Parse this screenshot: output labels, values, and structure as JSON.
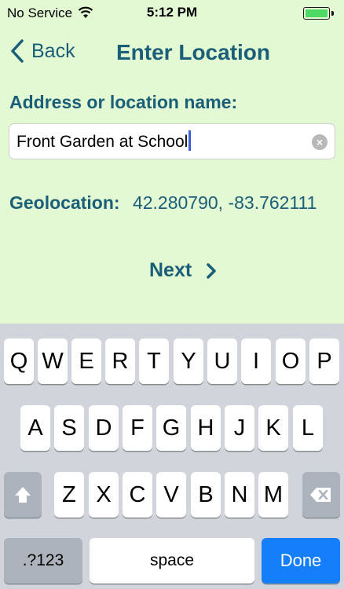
{
  "status_bar": {
    "carrier": "No Service",
    "time": "5:12 PM",
    "battery_level": 1.0,
    "battery_color": "#4cd964",
    "wifi_icon": "wifi-icon"
  },
  "nav": {
    "back_label": "Back",
    "title": "Enter Location"
  },
  "form": {
    "address_label": "Address or location name:",
    "address_value": "Front Garden at School",
    "geolocation_label": "Geolocation:",
    "geolocation_value": "42.280790, -83.762111",
    "next_label": "Next"
  },
  "keyboard": {
    "row1": [
      "Q",
      "W",
      "E",
      "R",
      "T",
      "Y",
      "U",
      "I",
      "O",
      "P"
    ],
    "row2": [
      "A",
      "S",
      "D",
      "F",
      "G",
      "H",
      "J",
      "K",
      "L"
    ],
    "row3": [
      "Z",
      "X",
      "C",
      "V",
      "B",
      "N",
      "M"
    ],
    "numbers_key": ".?123",
    "space_key": "space",
    "done_key": "Done"
  },
  "colors": {
    "background": "#e2f9d4",
    "accent": "#1b5e78",
    "done": "#157efb"
  }
}
